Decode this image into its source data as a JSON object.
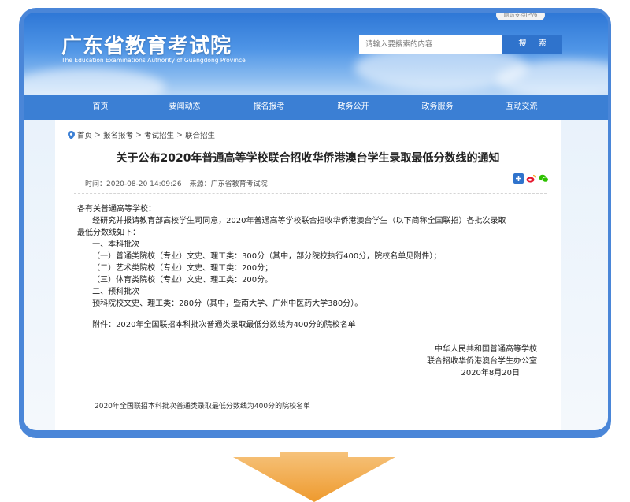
{
  "header": {
    "logo_cn": "广东省教育考试院",
    "logo_en": "The Education Examinations Authority of Guangdong Province",
    "top_badge": "网站支持IPv6",
    "search_placeholder": "请输入要搜索的内容",
    "search_button": "搜 索"
  },
  "nav": {
    "items": [
      "首页",
      "要闻动态",
      "报名报考",
      "政务公开",
      "政务服务",
      "互动交流"
    ]
  },
  "breadcrumb": {
    "items": [
      "首页",
      "报名报考",
      "考试招生",
      "联合招生"
    ],
    "separator": ">"
  },
  "article": {
    "title": "关于公布2020年普通高等学校联合招收华侨港澳台学生录取最低分数线的通知",
    "time": "时间：2020-08-20 14:09:26",
    "source": "来源：广东省教育考试院",
    "paragraphs": [
      "各有关普通高等学校：",
      "      经研究并报请教育部高校学生司同意，2020年普通高等学校联合招收华侨港澳台学生（以下简称全国联招）各批次录取",
      "最低分数线如下：",
      "      一、本科批次",
      "      （一）普通类院校（专业）文史、理工类：300分（其中，部分院校执行400分，院校名单见附件）；",
      "      （二）艺术类院校（专业）文史、理工类：200分；",
      "      （三）体育类院校（专业）文史、理工类：200分。",
      "      二、预科批次",
      "      预科院校文史、理工类：280分（其中，暨南大学、广州中医药大学380分）。"
    ],
    "attachment_line": "      附件：2020年全国联招本科批次普通类录取最低分数线为400分的院校名单",
    "signature": [
      "中华人民共和国普通高等学校",
      "联合招收华侨港澳台学生办公室",
      "2020年8月20日"
    ],
    "attachment_link": "2020年全国联招本科批次普通类录取最低分数线为400分的院校名单"
  },
  "colors": {
    "frame": "#4a86d8",
    "nav": "#3b7fd4",
    "search_button": "#2f73cc",
    "arrow": "#f0a440"
  }
}
